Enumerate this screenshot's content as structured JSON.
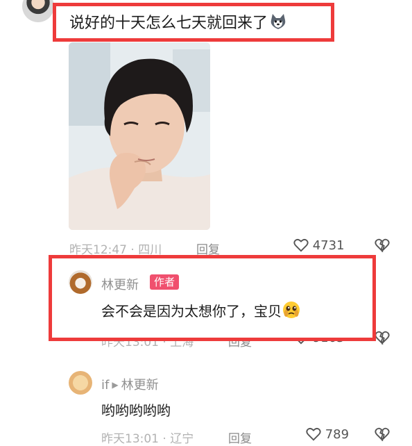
{
  "top_comment": {
    "text": "说好的十天怎么七天就回来了",
    "emoji_icon": "husky-emoji-icon",
    "time": "昨天12:47",
    "location": "四川",
    "reply_label": "回复",
    "like_count": "4731"
  },
  "author_reply": {
    "name": "林更新",
    "badge": "作者",
    "text": "会不会是因为太想你了，宝贝",
    "emoji_icon": "pleading-face-icon",
    "time": "昨天13:01",
    "location": "上海",
    "reply_label": "回复",
    "like_count": "9165"
  },
  "second_reply": {
    "name": "if",
    "reply_to": "林更新",
    "text": "哟哟哟哟哟",
    "time": "昨天13:01",
    "location": "辽宁",
    "reply_label": "回复",
    "like_count": "789"
  },
  "colors": {
    "highlight": "#ee3b3b",
    "badge": "#f0506e",
    "meta": "#b2b2b2"
  }
}
